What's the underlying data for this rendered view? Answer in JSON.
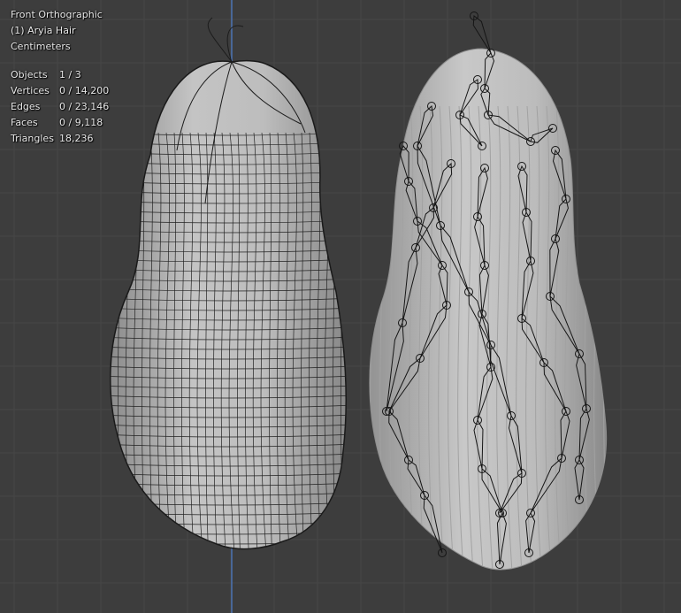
{
  "viewport": {
    "view_name": "Front Orthographic",
    "object_label": "(1) Aryia Hair",
    "units": "Centimeters",
    "stats": [
      {
        "label": "Objects",
        "value": "1 / 3"
      },
      {
        "label": "Vertices",
        "value": "0 / 14,200"
      },
      {
        "label": "Edges",
        "value": "0 / 23,146"
      },
      {
        "label": "Faces",
        "value": "0 / 9,118"
      },
      {
        "label": "Triangles",
        "value": "18,236"
      }
    ]
  },
  "colors": {
    "background": "#3d3d3d",
    "grid_line": "#484848",
    "axis_line": "#4d7bc4",
    "hair_fill": "#b9b9b9",
    "wire": "#1e1e1e",
    "bone": "#1a1a1a"
  },
  "objects": {
    "left": "hair-mesh-wireframe",
    "right": "hair-mesh-with-armature"
  }
}
